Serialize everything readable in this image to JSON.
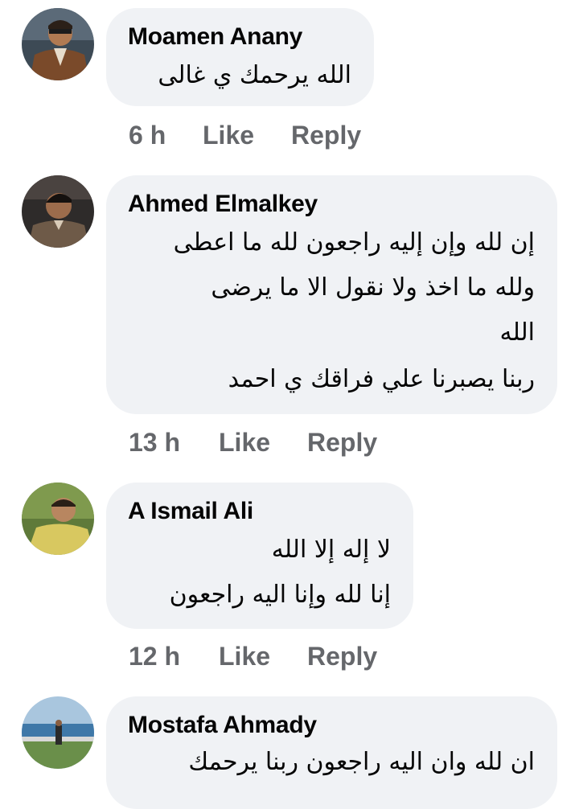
{
  "comments": [
    {
      "author": "Moamen Anany",
      "avatar_icon": "profile-photo-man-in-brown-jacket",
      "lines": [
        "الله يرحمك ي غالى"
      ],
      "time": "6 h",
      "like_label": "Like",
      "reply_label": "Reply"
    },
    {
      "author": "Ahmed Elmalkey",
      "avatar_icon": "profile-photo-young-man",
      "lines": [
        "إن لله وإن إليه راجعون لله ما اعطى",
        "ولله ما اخذ ولا نقول الا ما يرضى",
        "الله",
        "ربنا يصبرنا علي فراقك ي احمد"
      ],
      "time": "13 h",
      "like_label": "Like",
      "reply_label": "Reply"
    },
    {
      "author": "A Ismail Ali",
      "avatar_icon": "profile-photo-man-in-yellow-shirt",
      "lines": [
        "لا إله إلا الله",
        "إنا لله وإنا اليه راجعون"
      ],
      "time": "12 h",
      "like_label": "Like",
      "reply_label": "Reply"
    },
    {
      "author": "Mostafa Ahmady",
      "avatar_icon": "profile-photo-man-at-seaside",
      "lines": [
        "ان لله وان اليه راجعون ربنا يرحمك"
      ],
      "time": "",
      "like_label": "",
      "reply_label": ""
    }
  ],
  "colors": {
    "bubble_background": "#f0f2f5",
    "meta_text": "#65676b",
    "primary_text": "#050505"
  }
}
